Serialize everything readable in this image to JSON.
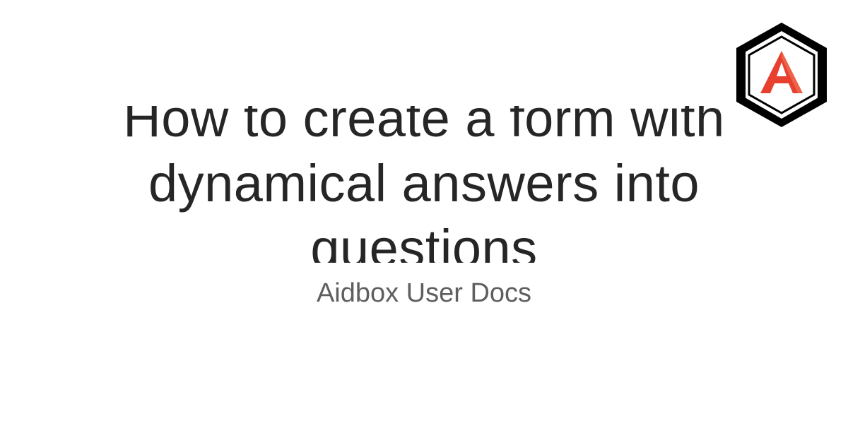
{
  "title": "How to create a form with dynamical answers into questions",
  "site_name": "Aidbox User Docs",
  "logo": {
    "letter": "A",
    "icon": "aidbox-hexagon-logo",
    "frame_color": "#000000",
    "letter_color": "#e8402f"
  }
}
